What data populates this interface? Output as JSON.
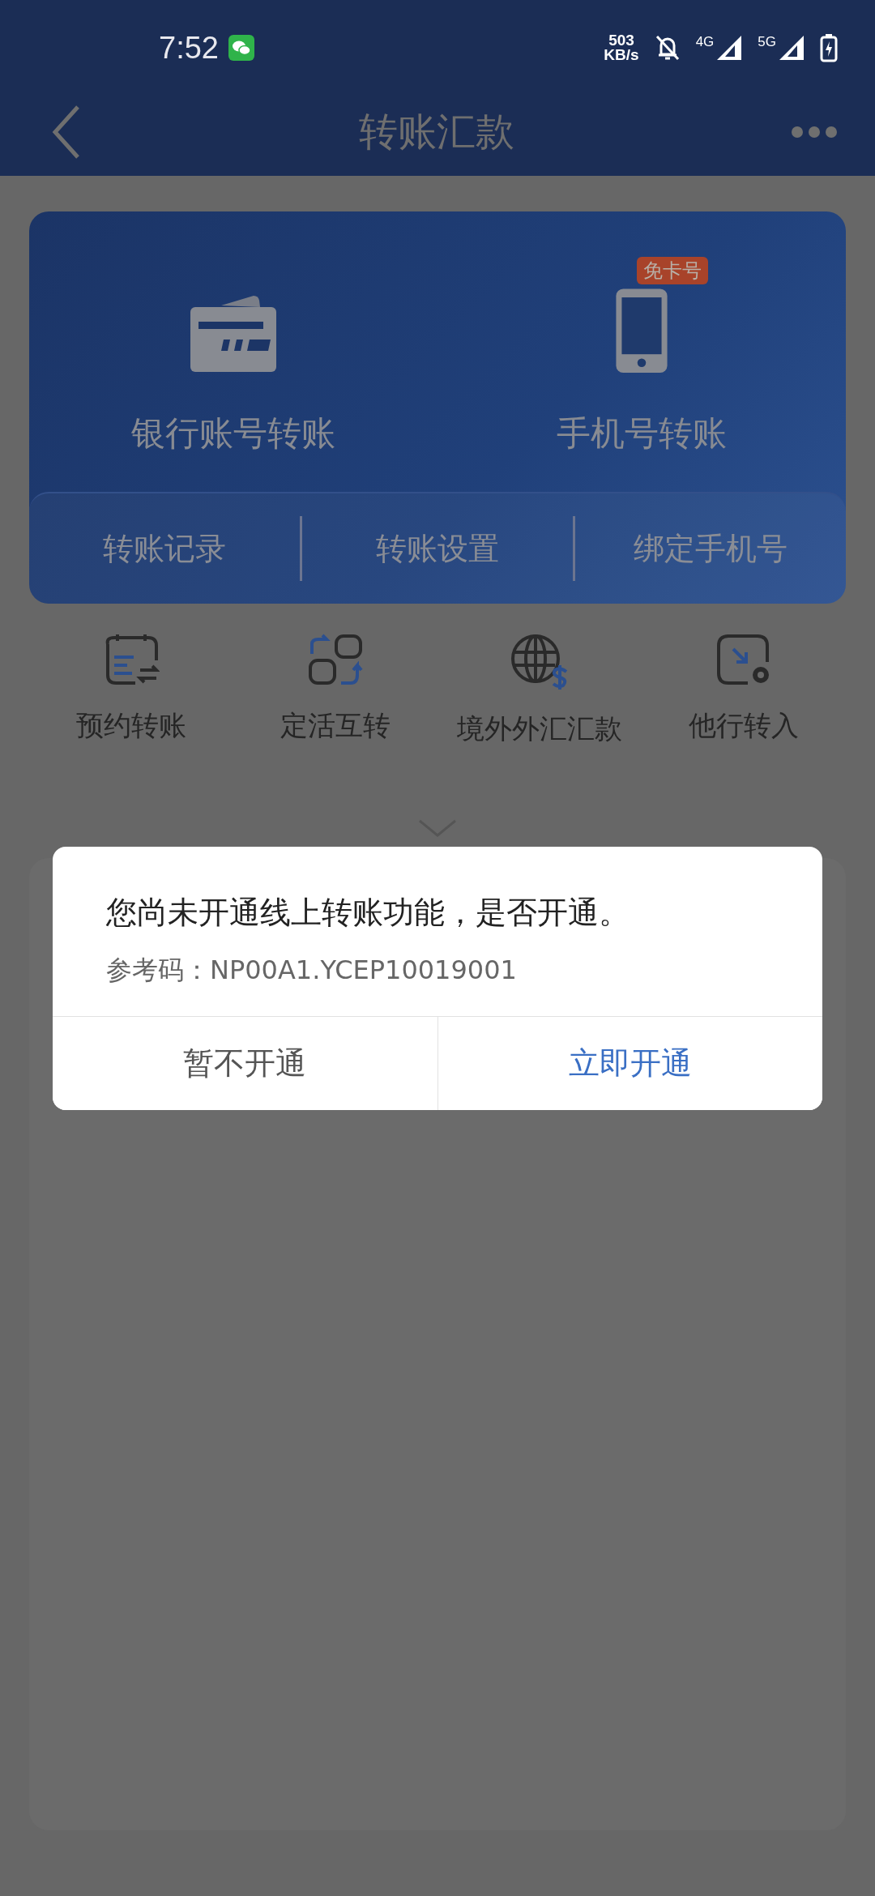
{
  "status_bar": {
    "time": "7:52",
    "speed_value": "503",
    "speed_unit": "KB/s",
    "signals": [
      "4G",
      "5G"
    ]
  },
  "header": {
    "title": "转账汇款"
  },
  "transfer_card": {
    "options": [
      {
        "label": "银行账号转账"
      },
      {
        "label": "手机号转账",
        "badge": "免卡号"
      }
    ],
    "links": [
      "转账记录",
      "转账设置",
      "绑定手机号"
    ]
  },
  "services": [
    "预约转账",
    "定活互转",
    "境外外汇汇款",
    "他行转入"
  ],
  "dialog": {
    "message": "您尚未开通线上转账功能，是否开通。",
    "reference": "参考码：NP00A1.YCEP10019001",
    "buttons": [
      {
        "label": "暂不开通",
        "kind": "cancel"
      },
      {
        "label": "立即开通",
        "kind": "confirm"
      }
    ]
  }
}
